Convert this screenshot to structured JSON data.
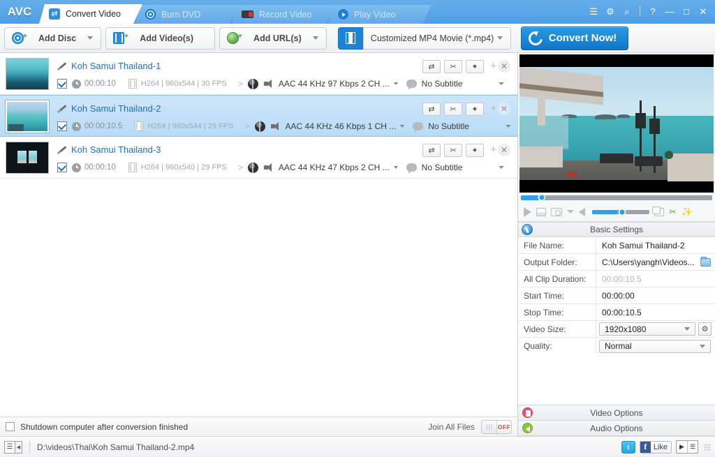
{
  "app": {
    "logo": "AVC"
  },
  "tabs": [
    {
      "label": "Convert Video",
      "icon": "refresh-icon",
      "active": true
    },
    {
      "label": "Burn DVD",
      "icon": "disc-icon",
      "active": false
    },
    {
      "label": "Record Video",
      "icon": "camcorder-icon",
      "active": false
    },
    {
      "label": "Play Video",
      "icon": "play-icon",
      "active": false
    }
  ],
  "window_controls": [
    {
      "name": "menu-list-icon",
      "glyph": "☰"
    },
    {
      "name": "gear-icon",
      "glyph": "⚙"
    },
    {
      "name": "search-icon",
      "glyph": "⌕"
    },
    {
      "name": "help-icon",
      "glyph": "?"
    },
    {
      "name": "minimize-icon",
      "glyph": "—"
    },
    {
      "name": "maximize-icon",
      "glyph": "□"
    },
    {
      "name": "close-icon",
      "glyph": "✕"
    }
  ],
  "toolbar": {
    "add_disc": "Add Disc",
    "add_videos": "Add Video(s)",
    "add_urls": "Add URL(s)",
    "preset": "Customized MP4 Movie (*.mp4)",
    "convert": "Convert Now!"
  },
  "files": [
    {
      "name": "Koh Samui Thailand-1",
      "checked": true,
      "duration": "00:00:10",
      "video_meta": "H264 | 960x544 | 30 FPS",
      "audio": "AAC 44 KHz 97 Kbps 2 CH ...",
      "subtitle": "No Subtitle",
      "selected": false
    },
    {
      "name": "Koh Samui Thailand-2",
      "checked": true,
      "duration": "00:00:10.5",
      "video_meta": "H264 | 960x544 | 29 FPS",
      "audio": "AAC 44 KHz 46 Kbps 1 CH ...",
      "subtitle": "No Subtitle",
      "selected": true
    },
    {
      "name": "Koh Samui Thailand-3",
      "checked": true,
      "duration": "00:00:10",
      "video_meta": "H264 | 960x540 | 29 FPS",
      "audio": "AAC 44 KHz 47 Kbps 2 CH ...",
      "subtitle": "No Subtitle",
      "selected": false
    }
  ],
  "row_tools": [
    {
      "name": "convert-row-icon",
      "glyph": "⇄"
    },
    {
      "name": "cut-row-icon",
      "glyph": "✂"
    },
    {
      "name": "effect-row-icon",
      "glyph": "✦"
    }
  ],
  "list_footer": {
    "shutdown_label": "Shutdown computer after conversion finished",
    "shutdown_checked": false,
    "join_label": "Join All Files",
    "join_state": "OFF"
  },
  "player": {
    "seek_percent": 13,
    "volume_percent": 52
  },
  "settings": {
    "header": "Basic Settings",
    "rows": [
      {
        "label": "File Name:",
        "value": "Koh Samui Thailand-2",
        "type": "text",
        "dim": false
      },
      {
        "label": "Output Folder:",
        "value": "C:\\Users\\yangh\\Videos...",
        "type": "folder",
        "dim": false
      },
      {
        "label": "All Clip Duration:",
        "value": "00:00:10.5",
        "type": "text",
        "dim": true
      },
      {
        "label": "Start Time:",
        "value": "00:00:00",
        "type": "text",
        "dim": false
      },
      {
        "label": "Stop Time:",
        "value": "00:00:10.5",
        "type": "text",
        "dim": false
      },
      {
        "label": "Video Size:",
        "value": "1920x1080",
        "type": "select-gear",
        "dim": false
      },
      {
        "label": "Quality:",
        "value": "Normal",
        "type": "select",
        "dim": false
      }
    ]
  },
  "options": {
    "video": "Video Options",
    "audio": "Audio Options"
  },
  "statusbar": {
    "path": "D:\\videos\\Thai\\Koh Samui Thailand-2.mp4",
    "twitter": "t",
    "facebook_f": "f",
    "facebook_like": "Like"
  },
  "colors": {
    "accent": "#1b84d6",
    "titlebar": "#5aa6e8",
    "selected_row": "#c4e1f8",
    "link": "#1f6fb8"
  }
}
